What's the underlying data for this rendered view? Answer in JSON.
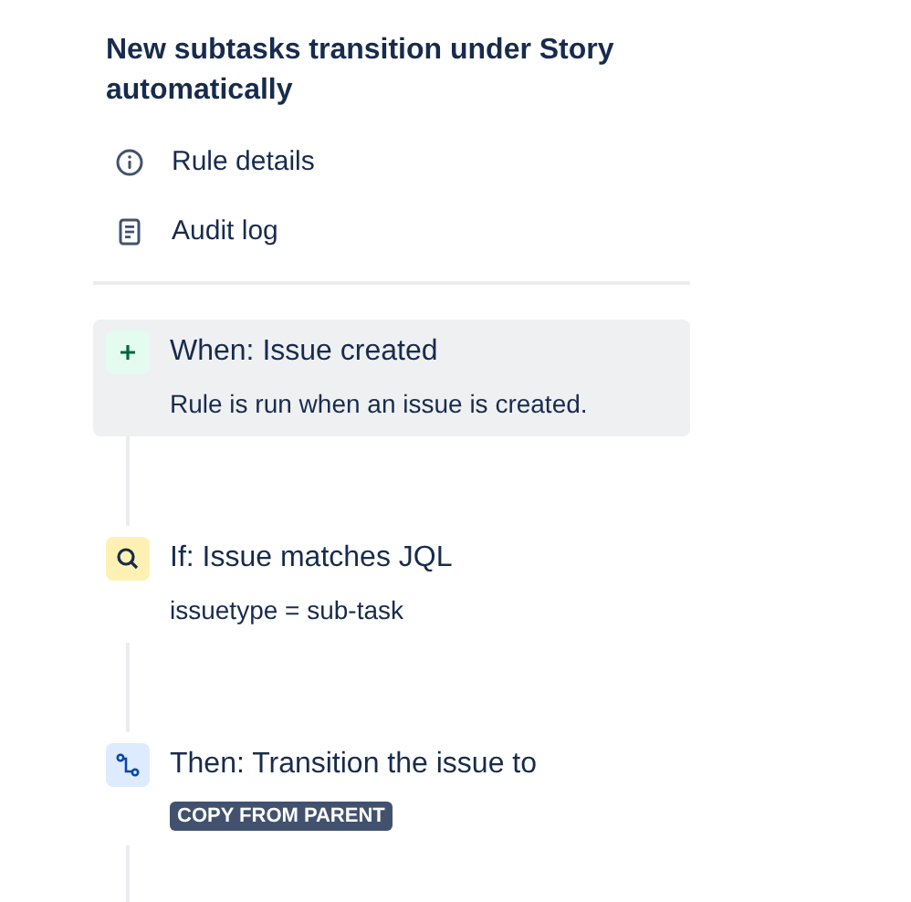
{
  "title": "New subtasks transition under Story automatically",
  "nav": [
    {
      "label": "Rule details",
      "kind": "info"
    },
    {
      "label": "Audit log",
      "kind": "log"
    }
  ],
  "steps": [
    {
      "kind": "trigger",
      "title": "When: Issue created",
      "selected": true,
      "detail": {
        "kind": "text",
        "text": "Rule is run when an issue is created."
      }
    },
    {
      "kind": "condition",
      "title": "If: Issue matches JQL",
      "selected": false,
      "detail": {
        "kind": "text",
        "text": "issuetype = sub-task"
      }
    },
    {
      "kind": "action",
      "title": "Then: Transition the issue to",
      "selected": false,
      "detail": {
        "kind": "lozenge",
        "text": "COPY FROM PARENT"
      }
    }
  ]
}
